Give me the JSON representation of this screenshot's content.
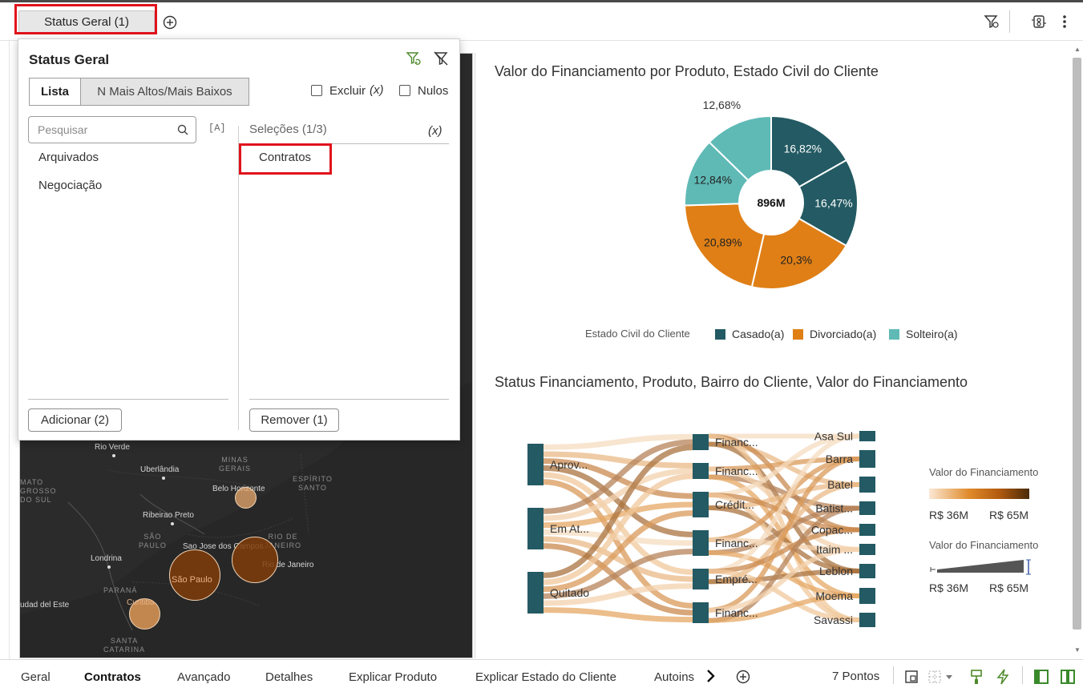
{
  "topbar": {
    "filter_chip_label": "Status Geral (1)"
  },
  "filter_panel": {
    "title": "Status Geral",
    "mode_list": "Lista",
    "mode_topn": "N Mais Altos/Mais Baixos",
    "exclude_label": "Excluir",
    "exclude_var": "(x)",
    "nulls_label": "Nulos",
    "search_placeholder": "Pesquisar",
    "case_icon_text": "[A]",
    "available_items": [
      "Arquivados",
      "Negociação"
    ],
    "selections_header": "Seleções (1/3)",
    "selections_var": "(x)",
    "selected_items": [
      "Contratos"
    ],
    "add_button": "Adicionar (2)",
    "remove_button": "Remover (1)"
  },
  "map": {
    "labels": {
      "rio_verde": "Rio Verde",
      "uberlandia": "Uberlândia",
      "belo_horizonte": "Belo Horizonte",
      "ribeirao_preto": "Ribeirao Preto",
      "londrina": "Londrina",
      "sao_jose": "Sao Jose dos Campos",
      "sao_paulo": "São Paulo",
      "rio": "Rio de Janeiro",
      "curitiba": "Curitiba",
      "cidade_leste": "udad del Este"
    },
    "regions": {
      "minas": "MINAS\nGERAIS",
      "espirito": "ESPÍRITO\nSANTO",
      "matogrosso": "MATO\nGROSSO\nDO SUL",
      "sao_paulo_state": "SÃO\nPAULO",
      "rio_state": "RIO DE\nJANEIRO",
      "parana": "PARANÁ",
      "santa_catarina": "SANTA\nCATARINA"
    }
  },
  "donut_chart": {
    "title": "Valor do Financiamento por Produto, Estado Civil do Cliente",
    "center_label": "896M",
    "legend_title": "Estado Civil do Cliente",
    "legend": [
      {
        "name": "Casado(a)",
        "color": "#235a63"
      },
      {
        "name": "Divorciado(a)",
        "color": "#df7f16"
      },
      {
        "name": "Solteiro(a)",
        "color": "#5fbab6"
      }
    ]
  },
  "sankey": {
    "title": "Status Financiamento, Produto, Bairro do Cliente, Valor do Financiamento",
    "col1": [
      "Aprov...",
      "Em At...",
      "Quitado"
    ],
    "col2": [
      "Financ...",
      "Financ...",
      "Crédit...",
      "Financ...",
      "Empré...",
      "Financ..."
    ],
    "col3": [
      "Asa Sul",
      "Barra",
      "Batel",
      "Batist...",
      "Copac...",
      "Itaim ...",
      "Leblon",
      "Moema",
      "Savassi"
    ],
    "legend_color_title": "Valor do Financiamento",
    "legend_color_min": "R$ 36M",
    "legend_color_max": "R$ 65M",
    "legend_size_title": "Valor do Financiamento",
    "legend_size_min": "R$ 36M",
    "legend_size_max": "R$ 65M"
  },
  "chart_data": {
    "type": "pie",
    "title": "Valor do Financiamento por Produto, Estado Civil do Cliente",
    "total_label": "896M",
    "slices": [
      {
        "label": "16,82%",
        "value": 16.82,
        "group": "Casado(a)",
        "color": "#235a63"
      },
      {
        "label": "16,47%",
        "value": 16.47,
        "group": "Casado(a)",
        "color": "#235a63"
      },
      {
        "label": "20,3%",
        "value": 20.3,
        "group": "Divorciado(a)",
        "color": "#df7f16"
      },
      {
        "label": "20,89%",
        "value": 20.89,
        "group": "Divorciado(a)",
        "color": "#df7f16"
      },
      {
        "label": "12,84%",
        "value": 12.84,
        "group": "Solteiro(a)",
        "color": "#5fbab6"
      },
      {
        "label": "12,68%",
        "value": 12.68,
        "group": "Solteiro(a)",
        "color": "#5fbab6"
      }
    ],
    "legend_title": "Estado Civil do Cliente",
    "legend_position": "bottom"
  },
  "bottombar": {
    "tabs": [
      "Geral",
      "Contratos",
      "Avançado",
      "Detalhes",
      "Explicar Produto",
      "Explicar Estado do Cliente",
      "Autoins"
    ],
    "active_tab": "Contratos",
    "points_label": "7 Pontos"
  }
}
